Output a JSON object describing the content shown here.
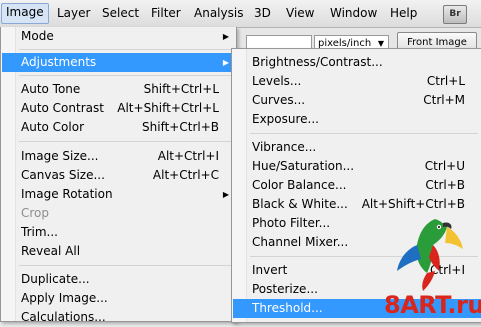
{
  "menubar": {
    "items": [
      {
        "label": "Image",
        "active": true
      },
      {
        "label": "Layer"
      },
      {
        "label": "Select"
      },
      {
        "label": "Filter"
      },
      {
        "label": "Analysis"
      },
      {
        "label": "3D"
      },
      {
        "label": "View"
      },
      {
        "label": "Window"
      },
      {
        "label": "Help"
      }
    ],
    "badge": "Br"
  },
  "options_bar": {
    "unit_value": "pixels/inch",
    "front_image_label": "Front Image"
  },
  "image_menu": [
    {
      "label": "Mode",
      "submenu": true
    },
    {
      "label": "Adjustments",
      "submenu": true,
      "highlighted": true
    },
    {
      "label": "Auto Tone",
      "shortcut": "Shift+Ctrl+L"
    },
    {
      "label": "Auto Contrast",
      "shortcut": "Alt+Shift+Ctrl+L"
    },
    {
      "label": "Auto Color",
      "shortcut": "Shift+Ctrl+B"
    },
    {
      "label": "Image Size...",
      "shortcut": "Alt+Ctrl+I"
    },
    {
      "label": "Canvas Size...",
      "shortcut": "Alt+Ctrl+C"
    },
    {
      "label": "Image Rotation",
      "submenu": true
    },
    {
      "label": "Crop",
      "disabled": true
    },
    {
      "label": "Trim..."
    },
    {
      "label": "Reveal All"
    },
    {
      "label": "Duplicate..."
    },
    {
      "label": "Apply Image..."
    },
    {
      "label": "Calculations..."
    }
  ],
  "adjustments_menu": [
    {
      "label": "Brightness/Contrast..."
    },
    {
      "label": "Levels...",
      "shortcut": "Ctrl+L"
    },
    {
      "label": "Curves...",
      "shortcut": "Ctrl+M"
    },
    {
      "label": "Exposure..."
    },
    {
      "label": "Vibrance..."
    },
    {
      "label": "Hue/Saturation...",
      "shortcut": "Ctrl+U"
    },
    {
      "label": "Color Balance...",
      "shortcut": "Ctrl+B"
    },
    {
      "label": "Black & White...",
      "shortcut": "Alt+Shift+Ctrl+B"
    },
    {
      "label": "Photo Filter..."
    },
    {
      "label": "Channel Mixer..."
    },
    {
      "label": "Invert",
      "shortcut": "Ctrl+I"
    },
    {
      "label": "Posterize..."
    },
    {
      "label": "Threshold...",
      "highlighted": true
    }
  ],
  "watermark": {
    "text": "8ART.ru"
  },
  "icons": {
    "submenu_arrow": "chevron-right-icon",
    "dropdown_arrow": "chevron-down-icon"
  },
  "colors": {
    "highlight": "#3399ff",
    "watermark": "#d9261c"
  }
}
